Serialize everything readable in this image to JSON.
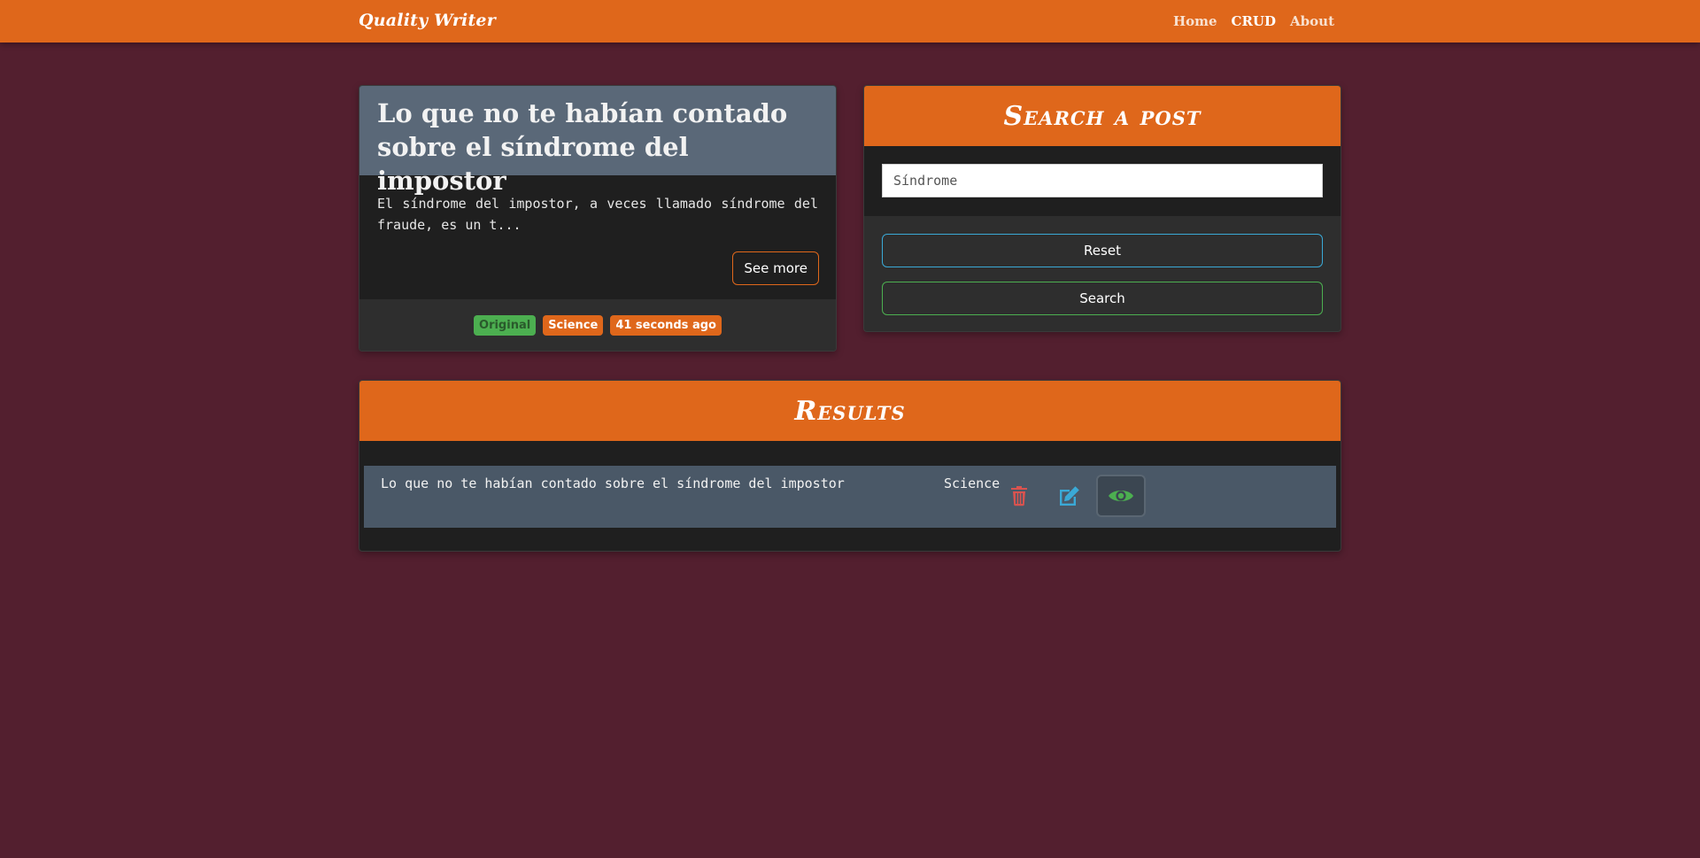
{
  "navbar": {
    "brand": "Quality Writer",
    "links": [
      {
        "label": "Home"
      },
      {
        "label": "CRUD"
      },
      {
        "label": "About"
      }
    ]
  },
  "post_card": {
    "title": "Lo que no te habían contado sobre el síndrome del impostor",
    "excerpt": "El síndrome del impostor, a veces llamado síndrome del fraude, es un t...",
    "see_more_label": "See more",
    "badges": {
      "original": "Original",
      "category": "Science",
      "time": "41 seconds ago"
    }
  },
  "search_card": {
    "title": "Search a post",
    "input_value": "Síndrome",
    "reset_label": "Reset",
    "search_label": "Search"
  },
  "results": {
    "title": "Results",
    "rows": [
      {
        "title": "Lo que no te habían contado sobre el síndrome del impostor",
        "category": "Science"
      }
    ],
    "icons": {
      "delete": "trash-icon",
      "edit": "edit-icon",
      "view": "eye-icon"
    }
  },
  "colors": {
    "background": "#531f2f",
    "accent": "#df671b",
    "card_header": "#5a6878",
    "card_body": "#1f1f1f",
    "success": "#4caf50",
    "info": "#3aa9d6",
    "danger": "#d9534f"
  }
}
